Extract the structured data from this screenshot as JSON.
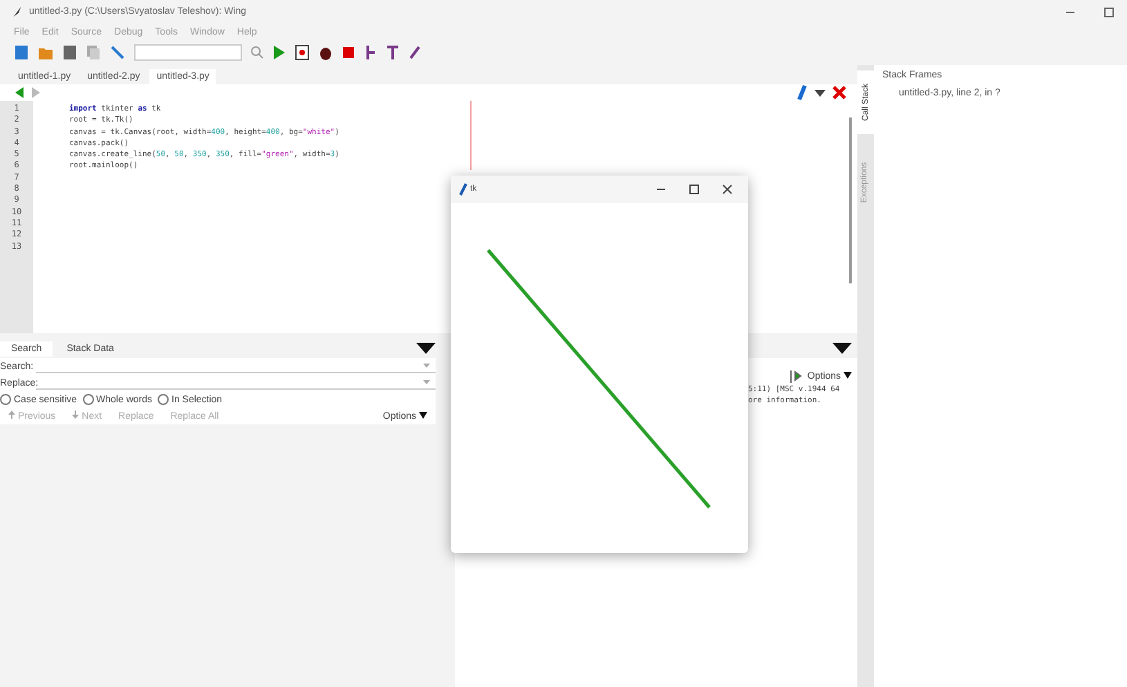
{
  "window": {
    "title": "untitled-3.py (C:\\Users\\Svyatoslav Teleshov): Wing"
  },
  "menu": [
    "File",
    "Edit",
    "Source",
    "Debug",
    "Tools",
    "Window",
    "Help"
  ],
  "tabs": [
    {
      "label": "untitled-1.py",
      "selected": false
    },
    {
      "label": "untitled-2.py",
      "selected": false
    },
    {
      "label": "untitled-3.py",
      "selected": true
    }
  ],
  "editor": {
    "lines": [
      [
        {
          "kind": "kw",
          "text": "import"
        },
        {
          "kind": "plain",
          "text": " tkinter "
        },
        {
          "kind": "kw",
          "text": "as"
        },
        {
          "kind": "plain",
          "text": " tk"
        }
      ],
      [
        {
          "kind": "plain",
          "text": "root = tk.Tk()"
        }
      ],
      [
        {
          "kind": "plain",
          "text": "canvas = tk.Canvas(root, width="
        },
        {
          "kind": "num",
          "text": "400"
        },
        {
          "kind": "plain",
          "text": ", height="
        },
        {
          "kind": "num",
          "text": "400"
        },
        {
          "kind": "plain",
          "text": ", bg="
        },
        {
          "kind": "str",
          "text": "\"white\""
        },
        {
          "kind": "plain",
          "text": ")"
        }
      ],
      [
        {
          "kind": "plain",
          "text": "canvas.pack()"
        }
      ],
      [
        {
          "kind": "plain",
          "text": "canvas.create_line("
        },
        {
          "kind": "num",
          "text": "50"
        },
        {
          "kind": "plain",
          "text": ", "
        },
        {
          "kind": "num",
          "text": "50"
        },
        {
          "kind": "plain",
          "text": ", "
        },
        {
          "kind": "num",
          "text": "350"
        },
        {
          "kind": "plain",
          "text": ", "
        },
        {
          "kind": "num",
          "text": "350"
        },
        {
          "kind": "plain",
          "text": ", fill="
        },
        {
          "kind": "str",
          "text": "\"green\""
        },
        {
          "kind": "plain",
          "text": ", width="
        },
        {
          "kind": "num",
          "text": "3"
        },
        {
          "kind": "plain",
          "text": ")"
        }
      ],
      [
        {
          "kind": "plain",
          "text": "root.mainloop()"
        }
      ]
    ],
    "line_numbers": [
      "1",
      "2",
      "3",
      "4",
      "5",
      "6",
      "7",
      "8",
      "9",
      "10",
      "11",
      "12",
      "13"
    ]
  },
  "search_panel": {
    "tabs": [
      {
        "label": "Search",
        "selected": true
      },
      {
        "label": "Stack Data",
        "selected": false
      }
    ],
    "search_label": "Search:",
    "replace_label": "Replace:",
    "options": [
      {
        "label": "Case sensitive",
        "checked": false
      },
      {
        "label": "Whole words",
        "checked": false
      },
      {
        "label": "In Selection",
        "checked": false
      }
    ],
    "buttons": [
      {
        "label": "Previous",
        "kind": "up"
      },
      {
        "label": "Next",
        "kind": "down"
      },
      {
        "label": "Replace",
        "kind": "plain"
      },
      {
        "label": "Replace All",
        "kind": "plain"
      }
    ],
    "options_button": "Options"
  },
  "shell": {
    "options_button": "Options",
    "output": [
      "5:11) [MSC v.1944 64",
      "ore information."
    ]
  },
  "side_tabs": [
    {
      "label": "Call Stack",
      "selected": true
    },
    {
      "label": "Exceptions",
      "selected": false
    }
  ],
  "stack": {
    "title": "Stack Frames",
    "frames": [
      "untitled-3.py, line 2, in ?"
    ]
  },
  "tk_window": {
    "title": "tk"
  }
}
